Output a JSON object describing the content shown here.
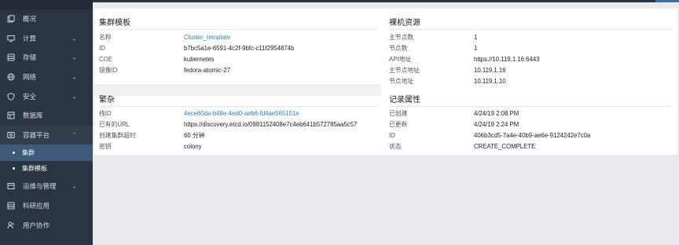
{
  "sidebar": {
    "items": [
      {
        "label": "概况",
        "icon": "overview-icon",
        "chevron": false
      },
      {
        "label": "计算",
        "icon": "monitor-icon",
        "chevron": true
      },
      {
        "label": "存储",
        "icon": "storage-icon",
        "chevron": true
      },
      {
        "label": "网络",
        "icon": "network-icon",
        "chevron": true
      },
      {
        "label": "安全",
        "icon": "shield-icon",
        "chevron": true
      },
      {
        "label": "数据库",
        "icon": "database-icon",
        "chevron": false
      },
      {
        "label": "容器平台",
        "icon": "container-icon",
        "chevron": true,
        "open": true
      },
      {
        "label": "运维与管理",
        "icon": "ops-icon",
        "chevron": true
      },
      {
        "label": "科研应用",
        "icon": "research-icon",
        "chevron": false
      },
      {
        "label": "用户协作",
        "icon": "users-icon",
        "chevron": false
      }
    ],
    "subitems": [
      {
        "label": "集群",
        "active": true
      },
      {
        "label": "集群模板",
        "active": false
      }
    ],
    "chevron_down": "⌄",
    "chevron_up": "⌃"
  },
  "cluster_template": {
    "title": "集群模板",
    "rows": [
      {
        "k": "名称",
        "v": "Cluster_template",
        "link": true
      },
      {
        "k": "ID",
        "v": "b7bc5a1e-6591-4c2f-9bfc-c11f2954874b",
        "link": false
      },
      {
        "k": "COE",
        "v": "kubernetes",
        "link": false
      },
      {
        "k": "镜像ID",
        "v": "fedora-atomic-27",
        "link": false
      }
    ]
  },
  "bare_metal": {
    "title": "裸机资源",
    "rows": [
      {
        "k": "主节点数",
        "v": "1"
      },
      {
        "k": "节点数",
        "v": "1"
      },
      {
        "k": "API地址",
        "v": "https://10.119.1.16:6443"
      },
      {
        "k": "主节点地址",
        "v": "10.119.1.16"
      },
      {
        "k": "节点地址",
        "v": "10.119.1.10"
      }
    ]
  },
  "misc": {
    "title": "繁杂",
    "rows": [
      {
        "k": "栈ID",
        "v": "4ece60da-b48e-4ed0-aeb6-fd4ae565151e",
        "link": true
      },
      {
        "k": "已有的URL",
        "v": "https://discovery.etcd.io/0981152408e7c4eb641b572785aa5c57",
        "link": false
      },
      {
        "k": "创建集群超时",
        "v": "60 分钟",
        "link": false
      },
      {
        "k": "密钥",
        "v": "colony",
        "link": false
      }
    ]
  },
  "record": {
    "title": "记录属性",
    "rows": [
      {
        "k": "已创建",
        "v": "4/24/19 2:08 PM"
      },
      {
        "k": "已更新",
        "v": "4/24/19 2:24 PM"
      },
      {
        "k": "ID",
        "v": "406b3cd5-7a4e-40b9-ae6e-9124242e7c0a"
      },
      {
        "k": "状态",
        "v": "CREATE_COMPLETE"
      }
    ]
  },
  "colors": {
    "sidebar_bg": "#2b3442",
    "active_sub_bg": "#3f5a79",
    "link": "#2f7ec4"
  }
}
